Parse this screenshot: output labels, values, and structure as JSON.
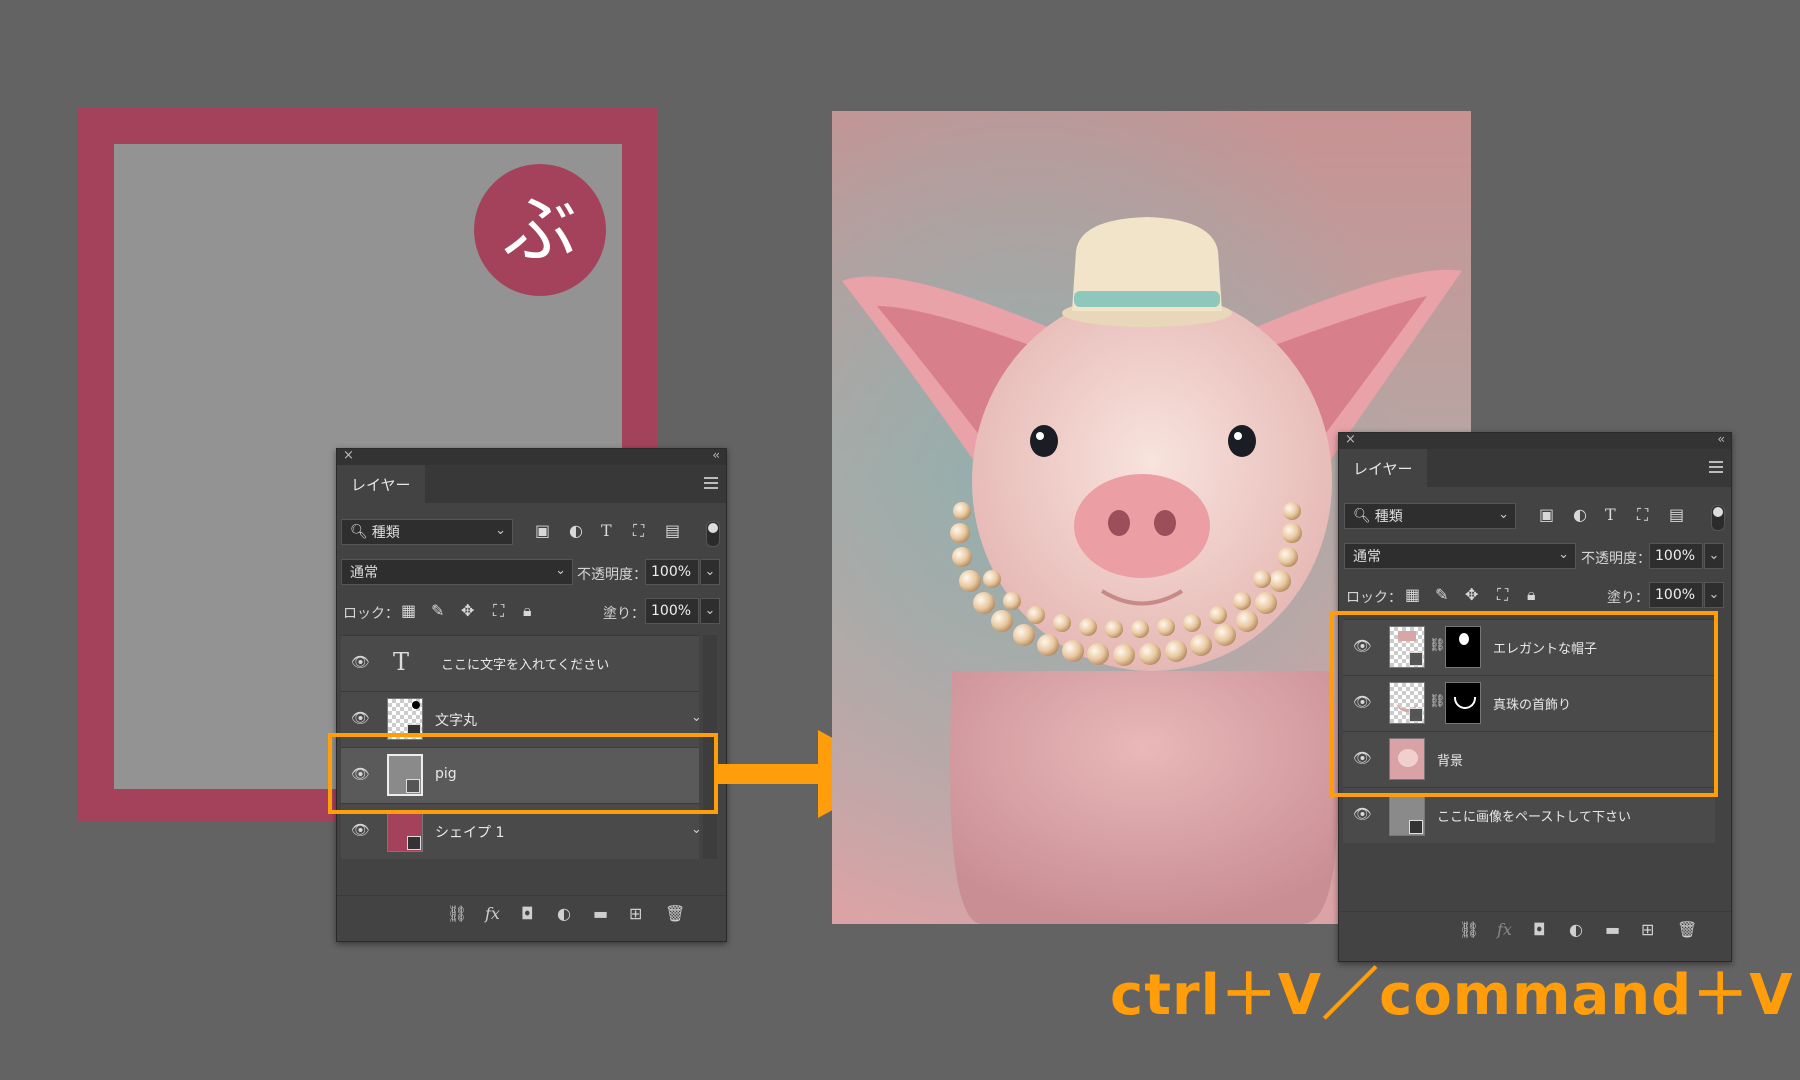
{
  "left_canvas": {
    "frame_color": "#a5425b",
    "inner_color": "#939393",
    "badge_char": "ぶ"
  },
  "panel_left": {
    "tab": "レイヤー",
    "filter_label": "種類",
    "blend_mode": "通常",
    "opacity_label": "不透明度：",
    "opacity_value": "100%",
    "lock_label": "ロック：",
    "fill_label": "塗り：",
    "fill_value": "100%",
    "layers": [
      {
        "name": "ここに文字を入れてください",
        "type": "text"
      },
      {
        "name": "文字丸",
        "type": "shape"
      },
      {
        "name": "pig",
        "type": "smart-object",
        "selected": true
      },
      {
        "name": "シェイプ 1",
        "type": "shape"
      }
    ]
  },
  "panel_right": {
    "tab": "レイヤー",
    "filter_label": "種類",
    "blend_mode": "通常",
    "opacity_label": "不透明度：",
    "opacity_value": "100%",
    "lock_label": "ロック：",
    "fill_label": "塗り：",
    "fill_value": "100%",
    "layers": [
      {
        "name": "エレガントな帽子",
        "type": "masked"
      },
      {
        "name": "真珠の首飾り",
        "type": "masked"
      },
      {
        "name": "背景",
        "type": "image"
      },
      {
        "name": "ここに画像をペーストして下さい",
        "type": "placeholder"
      }
    ]
  },
  "icons": {
    "eye": "eye-icon",
    "search": "search-icon",
    "link": "link-icon",
    "fx": "fx",
    "trash": "trash-icon"
  },
  "shortcut_text": "ctrl＋V／command＋V",
  "accent_color": "#ff9d0a"
}
